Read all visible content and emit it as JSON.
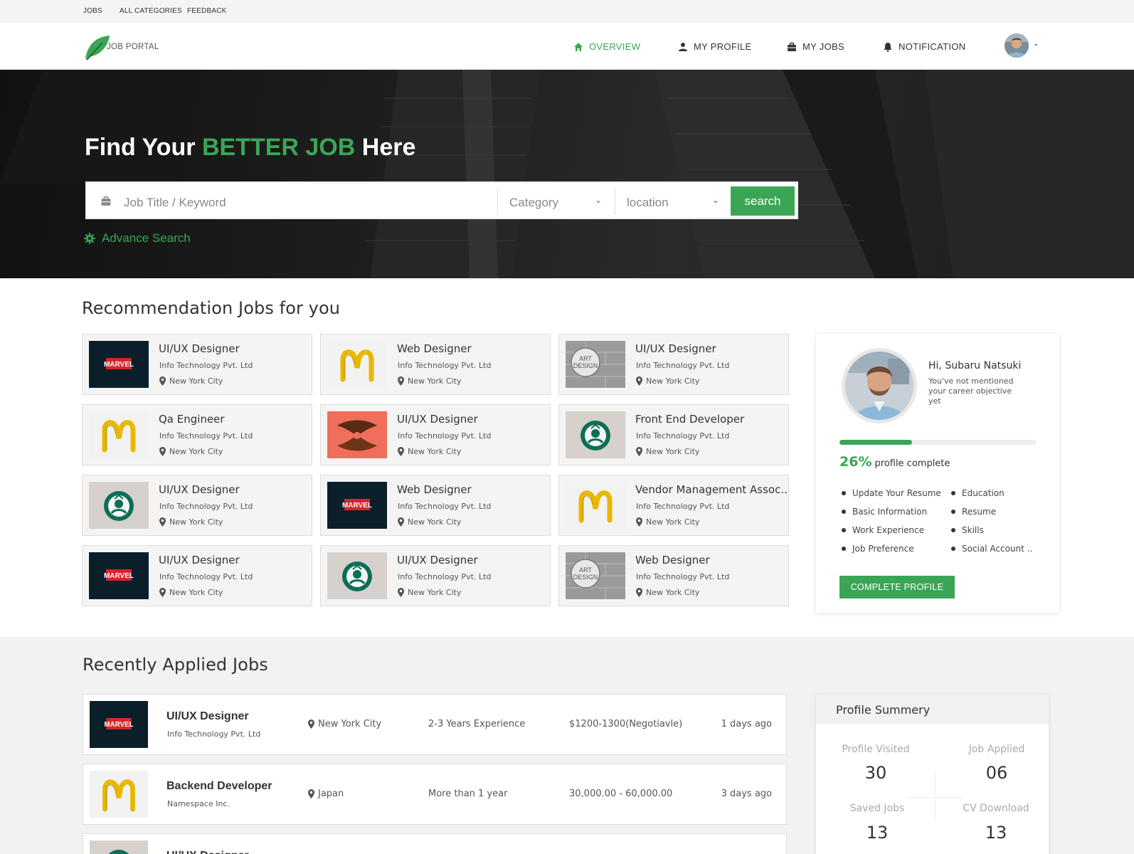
{
  "topbar": {
    "links": [
      "JOBS",
      "ALL CATEGORIES",
      "FEEDBACK"
    ]
  },
  "brand": {
    "name": "JOB PORTAL",
    "accent": "#3aa655"
  },
  "nav": {
    "items": [
      {
        "label": "OVERVIEW",
        "icon": "home-icon",
        "active": true
      },
      {
        "label": "MY PROFILE",
        "icon": "user-icon",
        "active": false
      },
      {
        "label": "MY JOBS",
        "icon": "briefcase-icon",
        "active": false
      },
      {
        "label": "NOTIFICATION",
        "icon": "bell-icon",
        "active": false
      }
    ]
  },
  "hero": {
    "title_pre": "Find Your ",
    "title_highlight": "BETTER JOB",
    "title_post": " Here",
    "search_placeholder": "Job Title / Keyword",
    "category_label": "Category",
    "location_label": "location",
    "search_button": "search",
    "advance_search": "Advance Search"
  },
  "recommendations": {
    "title": "Recommendation Jobs for you",
    "cards": [
      {
        "title": "UI/UX Designer",
        "company": "Info Technology Pvt. Ltd",
        "location": "New York City",
        "logo": "marvel"
      },
      {
        "title": "Web Designer",
        "company": "Info Technology Pvt. Ltd",
        "location": "New York City",
        "logo": "mcdonalds"
      },
      {
        "title": "UI/UX Designer",
        "company": "Info Technology Pvt. Ltd",
        "location": "New York City",
        "logo": "artdesign"
      },
      {
        "title": "Qa Engineer",
        "company": "Info Technology Pvt. Ltd",
        "location": "New York City",
        "logo": "mcdonalds"
      },
      {
        "title": "UI/UX Designer",
        "company": "Info Technology Pvt. Ltd",
        "location": "New York City",
        "logo": "pretzel"
      },
      {
        "title": "Front End Developer",
        "company": "Info Technology Pvt. Ltd",
        "location": "New York City",
        "logo": "starbucks"
      },
      {
        "title": "UI/UX Designer",
        "company": "Info Technology Pvt. Ltd",
        "location": "New York City",
        "logo": "starbucks"
      },
      {
        "title": "Web Designer",
        "company": "Info Technology Pvt. Ltd",
        "location": "New York City",
        "logo": "marvel"
      },
      {
        "title": "Vendor Management Assoc..",
        "company": "Info Technology Pvt. Ltd",
        "location": "New York City",
        "logo": "mcdonalds"
      },
      {
        "title": "UI/UX Designer",
        "company": "Info Technology Pvt. Ltd",
        "location": "New York City",
        "logo": "marvel"
      },
      {
        "title": "UI/UX Designer",
        "company": "Info Technology Pvt. Ltd",
        "location": "New York City",
        "logo": "starbucks"
      },
      {
        "title": "Web Designer",
        "company": "Info Technology Pvt. Ltd",
        "location": "New York City",
        "logo": "artdesign"
      }
    ]
  },
  "profile": {
    "greeting": "Hi, Subaru Natsuki",
    "note": "You've not mentioned your career objective yet",
    "progress_fraction": 0.37,
    "percent": "26%",
    "percent_label": "profile complete",
    "checklist_left": [
      "Update Your Resume",
      "Basic Information",
      "Work Experience",
      "Job Preference"
    ],
    "checklist_right": [
      "Education",
      "Resume",
      "Skills",
      "Social Account .."
    ],
    "complete_button": "COMPLETE PROFILE"
  },
  "applied": {
    "title": "Recently Applied Jobs",
    "rows": [
      {
        "title": "UI/UX Designer",
        "company": "Info Technology Pvt. Ltd",
        "location": "New York City",
        "experience": "2-3 Years Experience",
        "salary": "$1200-1300(Negotiavle)",
        "when": "1 days ago",
        "logo": "marvel"
      },
      {
        "title": "Backend Developer",
        "company": "Namespace Inc.",
        "location": "Japan",
        "experience": "More than 1 year",
        "salary": "30,000.00 - 60,000.00",
        "when": "3 days ago",
        "logo": "mcdonalds"
      },
      {
        "title": "UI/UX Designer",
        "company": "",
        "location": "",
        "experience": "",
        "salary": "",
        "when": "",
        "logo": "starbucks"
      }
    ]
  },
  "summary": {
    "title": "Profile Summery",
    "stats": [
      {
        "label": "Profile Visited",
        "value": "30"
      },
      {
        "label": "Job Applied",
        "value": "06"
      },
      {
        "label": "Saved Jobs",
        "value": "13"
      },
      {
        "label": "CV Download",
        "value": "13"
      }
    ]
  }
}
